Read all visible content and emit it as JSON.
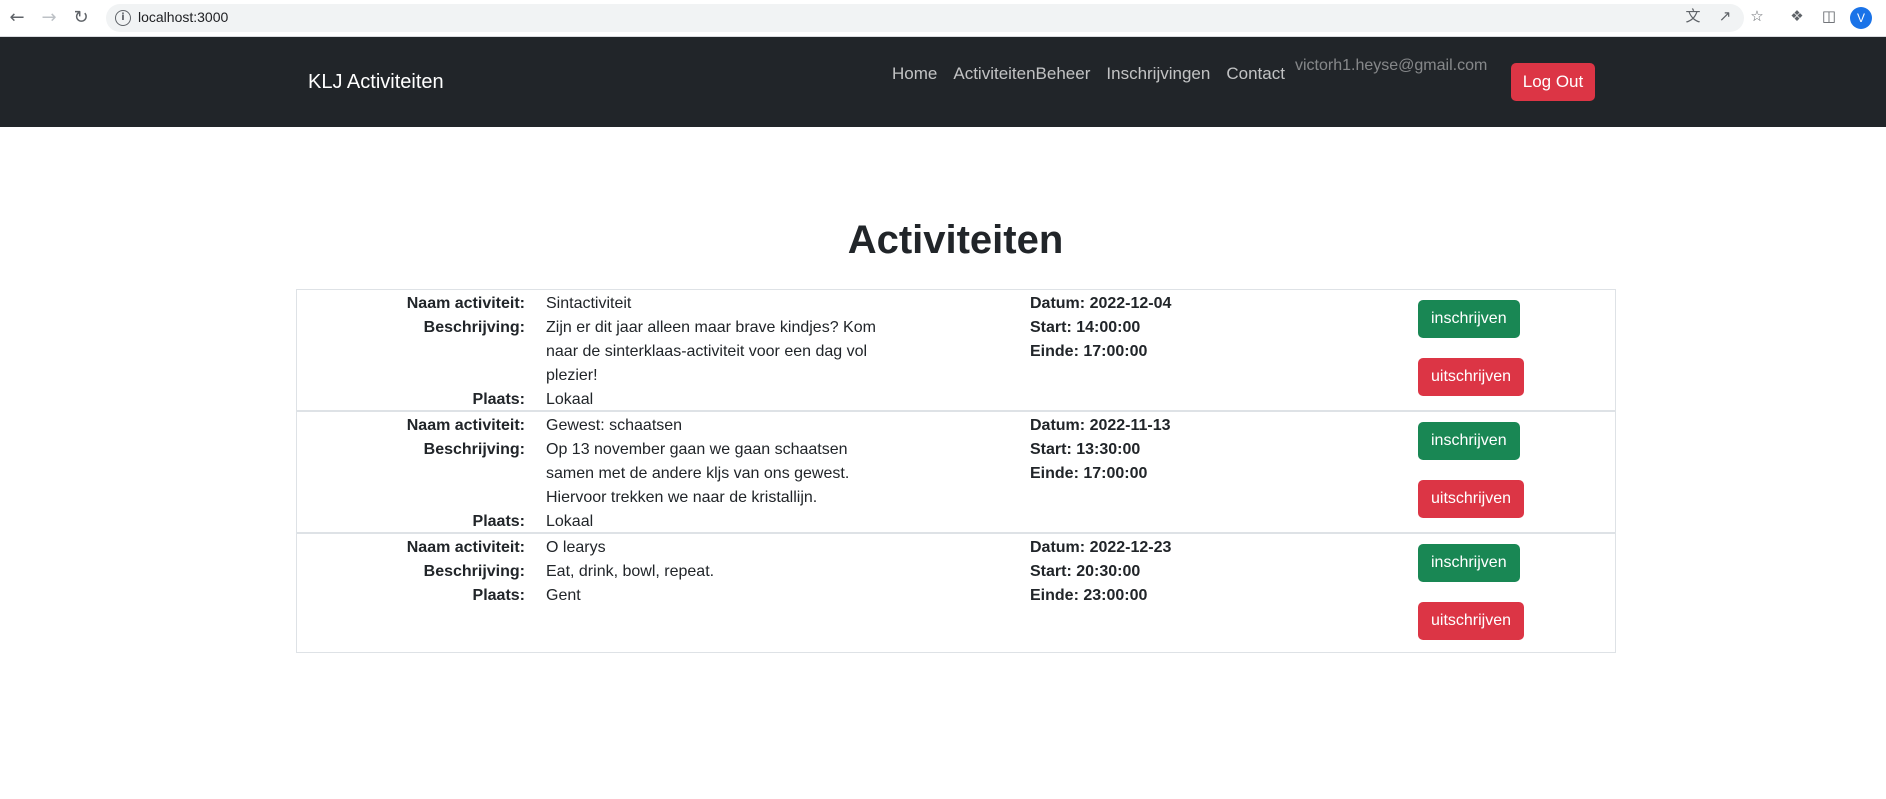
{
  "browser": {
    "url": "localhost:3000",
    "profile_initial": "V"
  },
  "navbar": {
    "brand": "KLJ Activiteiten",
    "links": [
      "Home",
      "ActiviteitenBeheer",
      "Inschrijvingen",
      "Contact"
    ],
    "user_email": "victorh1.heyse@gmail.com",
    "logout_label": "Log Out"
  },
  "main": {
    "title": "Activiteiten",
    "labels": {
      "name": "Naam activiteit:",
      "description": "Beschrijving:",
      "place": "Plaats:",
      "date": "Datum:",
      "start": "Start:",
      "end": "Einde:"
    },
    "buttons": {
      "subscribe": "inschrijven",
      "unsubscribe": "uitschrijven"
    },
    "activities": [
      {
        "name": "Sintactiviteit",
        "description": "Zijn er dit jaar alleen maar brave kindjes? Kom naar de sinterklaas-activiteit voor een dag vol plezier!",
        "place": "Lokaal",
        "date": "2022-12-04",
        "start": "14:00:00",
        "end": "17:00:00"
      },
      {
        "name": "Gewest: schaatsen",
        "description": "Op 13 november gaan we gaan schaatsen samen met de andere kljs van ons gewest. Hiervoor trekken we naar de kristallijn.",
        "place": "Lokaal",
        "date": "2022-11-13",
        "start": "13:30:00",
        "end": "17:00:00"
      },
      {
        "name": "O learys",
        "description": "Eat, drink, bowl, repeat.",
        "place": "Gent",
        "date": "2022-12-23",
        "start": "20:30:00",
        "end": "23:00:00"
      }
    ]
  },
  "colors": {
    "navbar_bg": "#212529",
    "success": "#198754",
    "danger": "#dc3545"
  }
}
